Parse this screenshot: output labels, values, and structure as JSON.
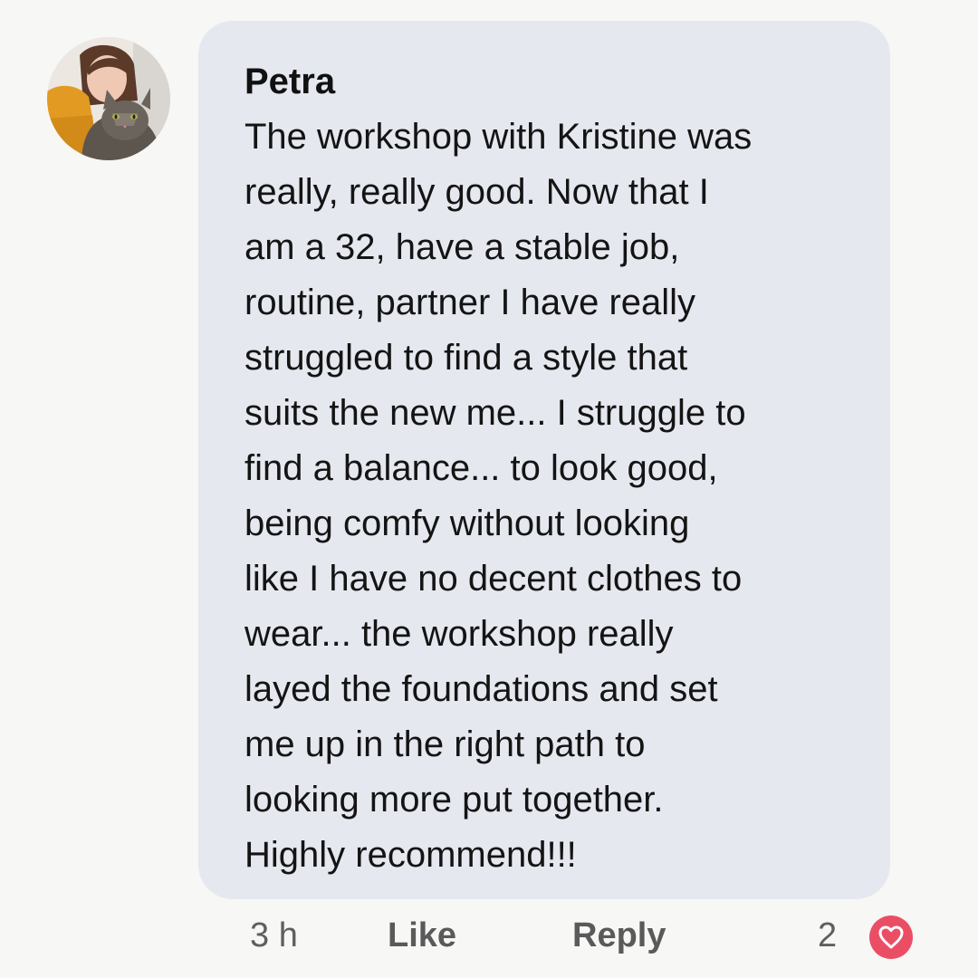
{
  "comment": {
    "author": "Petra",
    "body_lines": [
      "The workshop with Kristine was",
      "really, really good. Now that I",
      "am a 32, have a stable job,",
      "routine, partner I have really",
      "struggled to find a style that",
      "suits the new me... I struggle to",
      "find a balance... to look good,",
      "being comfy without looking",
      "like I have no decent clothes to",
      "wear... the workshop really",
      "layed the foundations and set",
      "me up in the right path to",
      "looking more put together.",
      "Highly recommend!!!"
    ]
  },
  "actions": {
    "time": "3 h",
    "like_label": "Like",
    "reply_label": "Reply",
    "reaction_count": "2",
    "reaction_icon": "heart-icon"
  },
  "colors": {
    "bubble": "#e6e8ef",
    "background": "#f7f7f5",
    "reaction": "#ea4e65"
  }
}
